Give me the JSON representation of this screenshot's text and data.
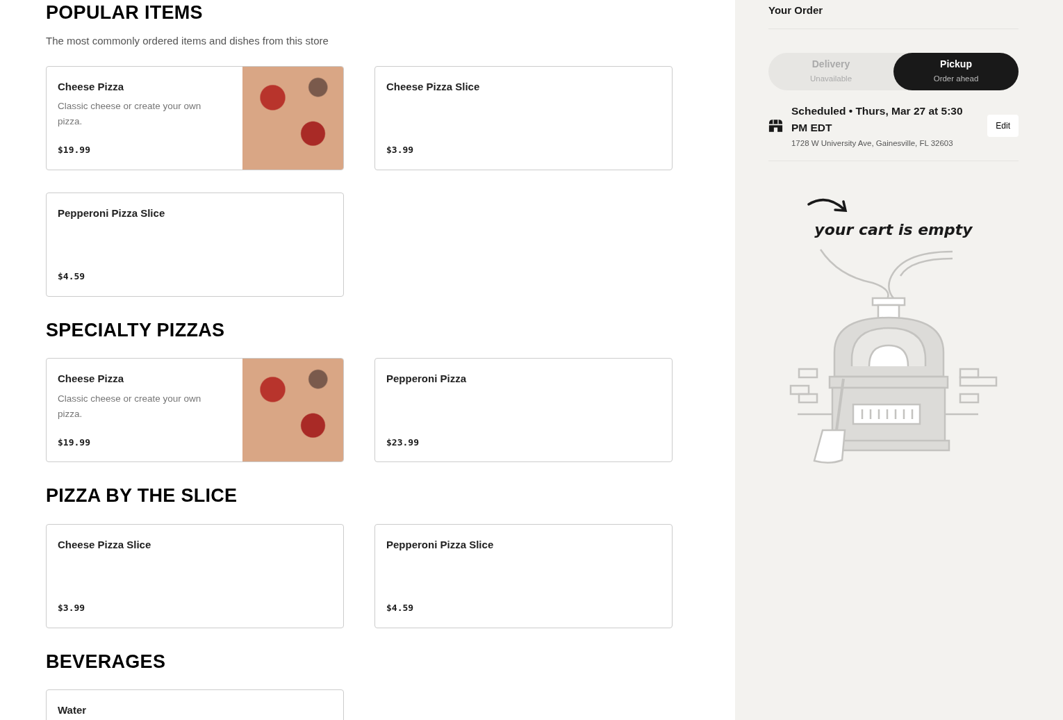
{
  "sections": [
    {
      "title": "POPULAR ITEMS",
      "subtitle": "The most commonly ordered items and dishes from this store",
      "items": [
        {
          "name": "Cheese Pizza",
          "description": "Classic cheese or create your own pizza.",
          "price": "$19.99",
          "photo": true
        },
        {
          "name": "Cheese Pizza Slice",
          "price": "$3.99",
          "photo": false
        },
        {
          "name": "Pepperoni Pizza Slice",
          "price": "$4.59",
          "photo": false
        }
      ]
    },
    {
      "title": "SPECIALTY PIZZAS",
      "items": [
        {
          "name": "Cheese Pizza",
          "description": "Classic cheese or create your own pizza.",
          "price": "$19.99",
          "photo": true
        },
        {
          "name": "Pepperoni Pizza",
          "price": "$23.99",
          "photo": false
        }
      ]
    },
    {
      "title": "PIZZA BY THE SLICE",
      "items": [
        {
          "name": "Cheese Pizza Slice",
          "price": "$3.99",
          "photo": false
        },
        {
          "name": "Pepperoni Pizza Slice",
          "price": "$4.59",
          "photo": false
        }
      ]
    },
    {
      "title": "BEVERAGES",
      "items": [
        {
          "name": "Water",
          "photo": false
        }
      ]
    }
  ],
  "order": {
    "title": "Your Order",
    "modes": [
      {
        "label": "Delivery",
        "sublabel": "Unavailable",
        "selected": false,
        "disabled": true
      },
      {
        "label": "Pickup",
        "sublabel": "Order ahead",
        "selected": true,
        "disabled": false
      }
    ],
    "schedule": {
      "text": "Scheduled • Thurs, Mar 27 at 5:30 PM EDT",
      "address": "1728 W University Ave, Gainesville, FL 32603",
      "button": "Edit"
    },
    "empty_cart": "your cart is empty"
  }
}
